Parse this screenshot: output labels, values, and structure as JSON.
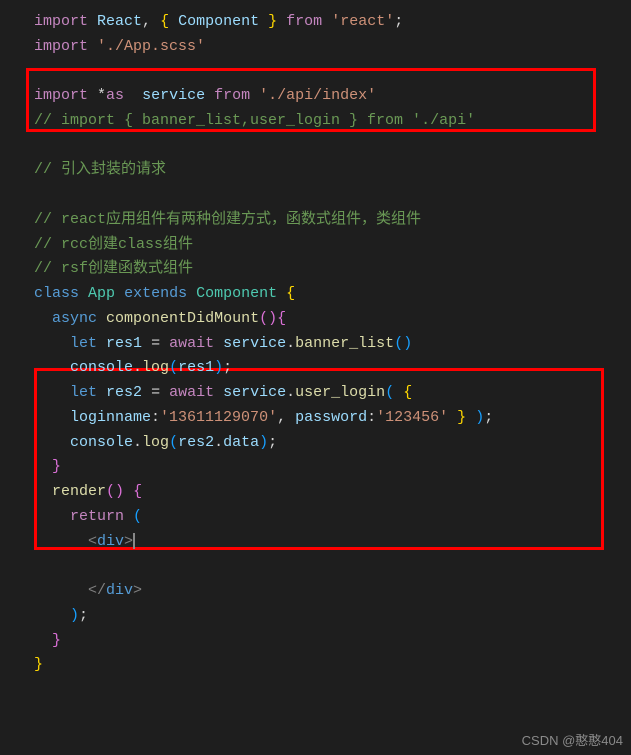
{
  "lines": {
    "l1": {
      "kw_import": "import",
      "react": "React",
      "comma": ",",
      "lbrace": "{",
      "component": "Component",
      "rbrace": "}",
      "kw_from": "from",
      "str": "'react'",
      "semi": ";"
    },
    "l2": {
      "kw_import": "import",
      "str": "'./App.scss'"
    },
    "l3": {
      "kw_import": "import",
      "star": "*",
      "as": "as",
      "service": "service",
      "kw_from": "from",
      "str": "'./api/index'"
    },
    "l4": {
      "comment": "// import { banner_list,user_login } from './api'"
    },
    "l5": {
      "comment": "// 引入封装的请求"
    },
    "l6": {
      "comment": "// react应用组件有两种创建方式，函数式组件，类组件"
    },
    "l7": {
      "comment": "// rcc创建class组件"
    },
    "l8": {
      "comment": "// rsf创建函数式组件"
    },
    "l9": {
      "kw_class": "class",
      "app": "App",
      "kw_extends": "extends",
      "component": "Component",
      "lbrace": "{"
    },
    "l10": {
      "kw_async": "async",
      "func": "componentDidMount",
      "paren": "()",
      "lbrace": "{"
    },
    "l11": {
      "kw_let": "let",
      "res": "res1",
      "eq": "=",
      "kw_await": "await",
      "service": "service",
      "dot": ".",
      "fn": "banner_list",
      "paren": "()"
    },
    "l12": {
      "console": "console",
      "dot": ".",
      "log": "log",
      "lp": "(",
      "res": "res1",
      "rp": ")",
      "semi": ";"
    },
    "l13": {
      "kw_let": "let",
      "res": "res2",
      "eq": "=",
      "kw_await": "await",
      "service": "service",
      "dot": ".",
      "fn": "user_login",
      "lp": "(",
      "lbrace": "{"
    },
    "l14": {
      "k1": "loginname",
      "c1": ":",
      "v1": "'13611129070'",
      "comma": ",",
      "k2": "password",
      "c2": ":",
      "v2": "'123456'",
      "rbrace": "}",
      "rp": ")",
      "semi": ";"
    },
    "l15": {
      "console": "console",
      "dot": ".",
      "log": "log",
      "lp": "(",
      "res": "res2",
      "d2": ".",
      "data": "data",
      "rp": ")",
      "semi": ";"
    },
    "l16": {
      "rbrace": "}"
    },
    "l17": {
      "func": "render",
      "paren": "()",
      "lbrace": "{"
    },
    "l18": {
      "kw_return": "return",
      "lp": "("
    },
    "l19": {
      "lt": "<",
      "div": "div",
      "gt": ">"
    },
    "l20": {
      "lt": "</",
      "div": "div",
      "gt": ">"
    },
    "l21": {
      "rp": ")",
      "semi": ";"
    },
    "l22": {
      "rbrace": "}"
    },
    "l23": {
      "rbrace": "}"
    }
  },
  "watermark": "CSDN @憨憨404"
}
